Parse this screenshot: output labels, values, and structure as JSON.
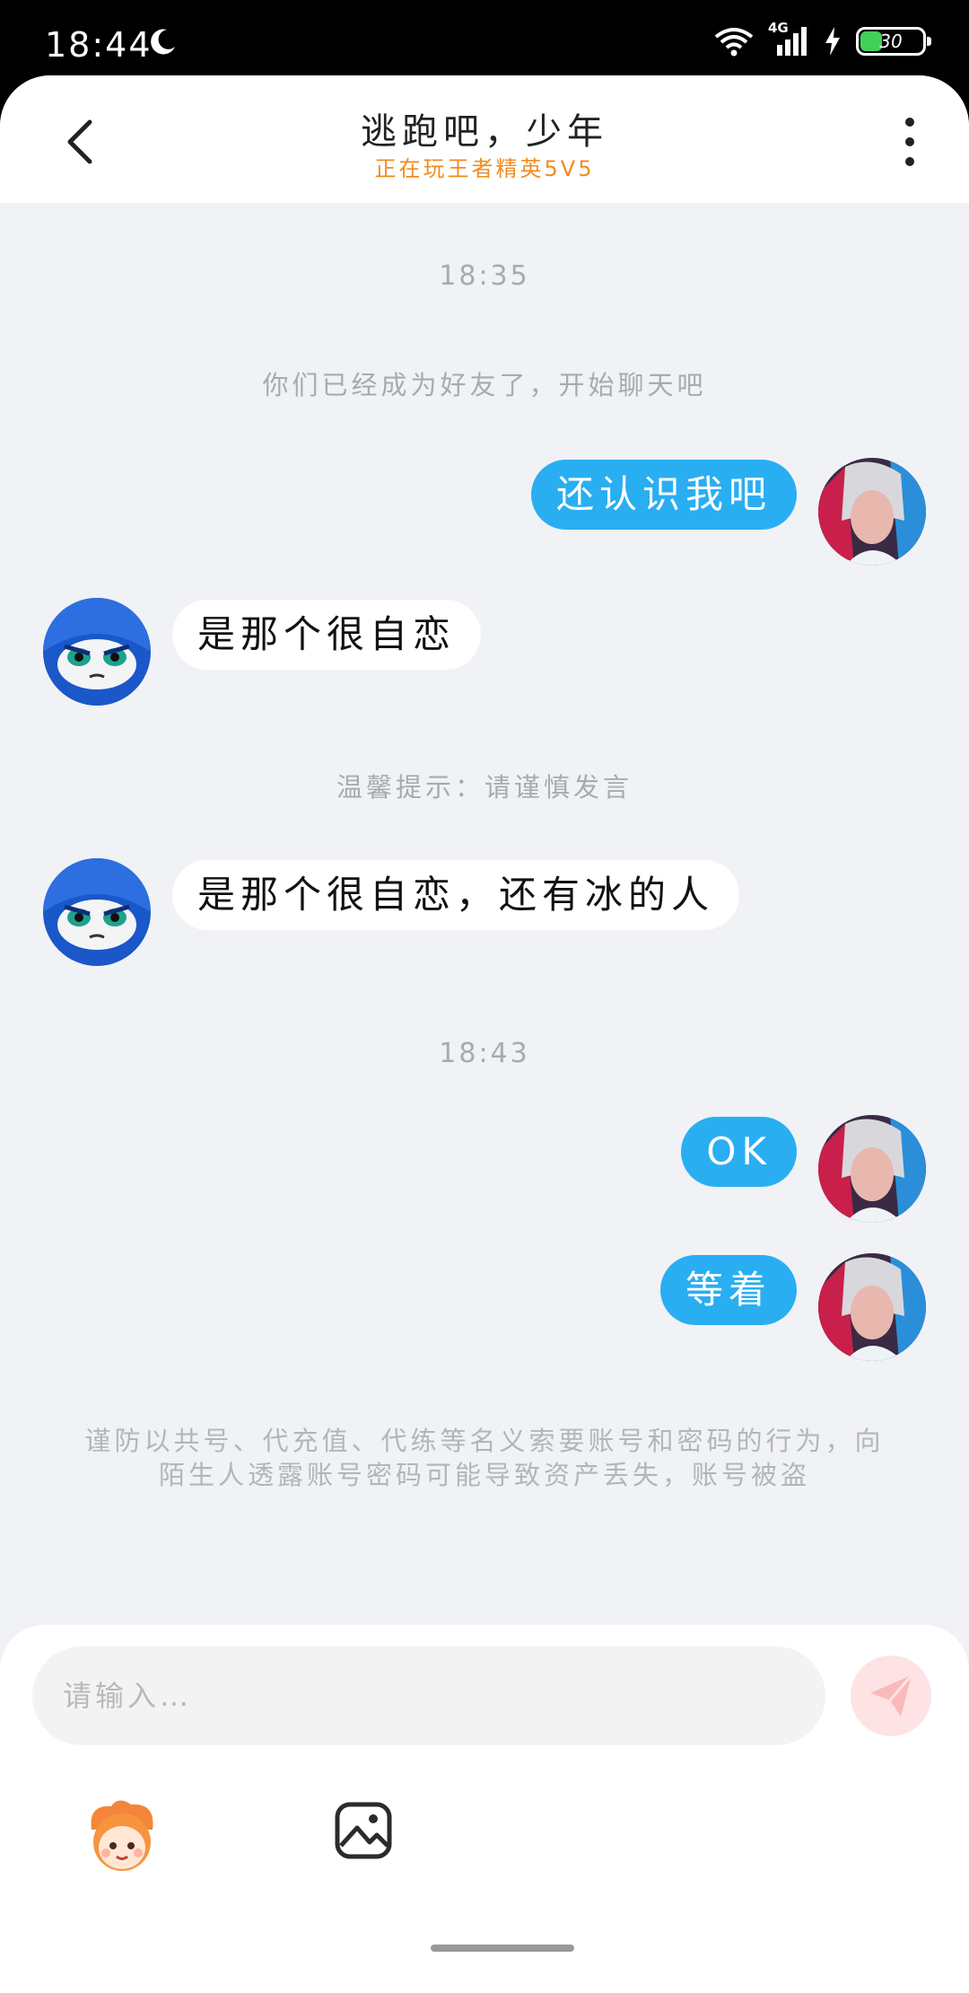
{
  "status_bar": {
    "time": "18:44",
    "network": "4G",
    "battery": "30"
  },
  "header": {
    "title": "逃跑吧，少年",
    "status": "正在玩王者精英5V5"
  },
  "timestamps": [
    "18:35",
    "18:43"
  ],
  "system": {
    "friend_notice": "你们已经成为好友了，开始聊天吧",
    "caution": "温馨提示：请谨慎发言",
    "security_warning": "谨防以共号、代充值、代练等名义索要账号和密码的行为，向陌生人透露账号密码可能导致资产丢失，账号被盗"
  },
  "messages": [
    {
      "side": "out",
      "text": "还认识我吧"
    },
    {
      "side": "in",
      "text": "是那个很自恋"
    },
    {
      "side": "in",
      "text": "是那个很自恋，还有冰的人"
    },
    {
      "side": "out",
      "text": "OK"
    },
    {
      "side": "out",
      "text": "等着"
    }
  ],
  "composer": {
    "placeholder": "请输入…",
    "value": ""
  },
  "icons": [
    "back-icon",
    "more-icon",
    "send-icon",
    "emoji-icon",
    "image-icon",
    "wifi-icon",
    "signal-icon",
    "moon-icon"
  ],
  "colors": {
    "outgoing_bubble": "#2aaef2",
    "status_orange": "#f28b1f",
    "background": "#f0f2f6"
  }
}
